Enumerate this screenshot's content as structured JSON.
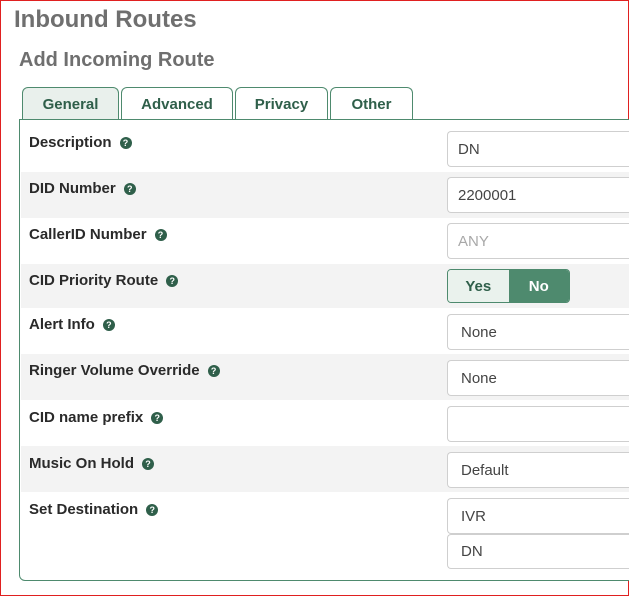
{
  "header": {
    "title": "Inbound Routes",
    "subtitle": "Add Incoming Route"
  },
  "tabs": [
    {
      "label": "General",
      "active": true
    },
    {
      "label": "Advanced",
      "active": false
    },
    {
      "label": "Privacy",
      "active": false
    },
    {
      "label": "Other",
      "active": false
    }
  ],
  "form": {
    "description": {
      "label": "Description",
      "value": "DN"
    },
    "did_number": {
      "label": "DID Number",
      "value": "2200001"
    },
    "callerid_number": {
      "label": "CallerID Number",
      "placeholder": "ANY"
    },
    "cid_priority_route": {
      "label": "CID Priority Route",
      "yes_label": "Yes",
      "no_label": "No",
      "selected": "No"
    },
    "alert_info": {
      "label": "Alert Info",
      "value": "None"
    },
    "ringer_volume_override": {
      "label": "Ringer Volume Override",
      "value": "None"
    },
    "cid_name_prefix": {
      "label": "CID name prefix",
      "value": ""
    },
    "music_on_hold": {
      "label": "Music On Hold",
      "value": "Default"
    },
    "set_destination": {
      "label": "Set Destination",
      "value": "IVR",
      "sub_value": "DN"
    }
  },
  "help_icon_glyph": "?",
  "colors": {
    "accent": "#4e8a6e",
    "title_gray": "#6f6f6f",
    "border_red": "#e02020"
  }
}
